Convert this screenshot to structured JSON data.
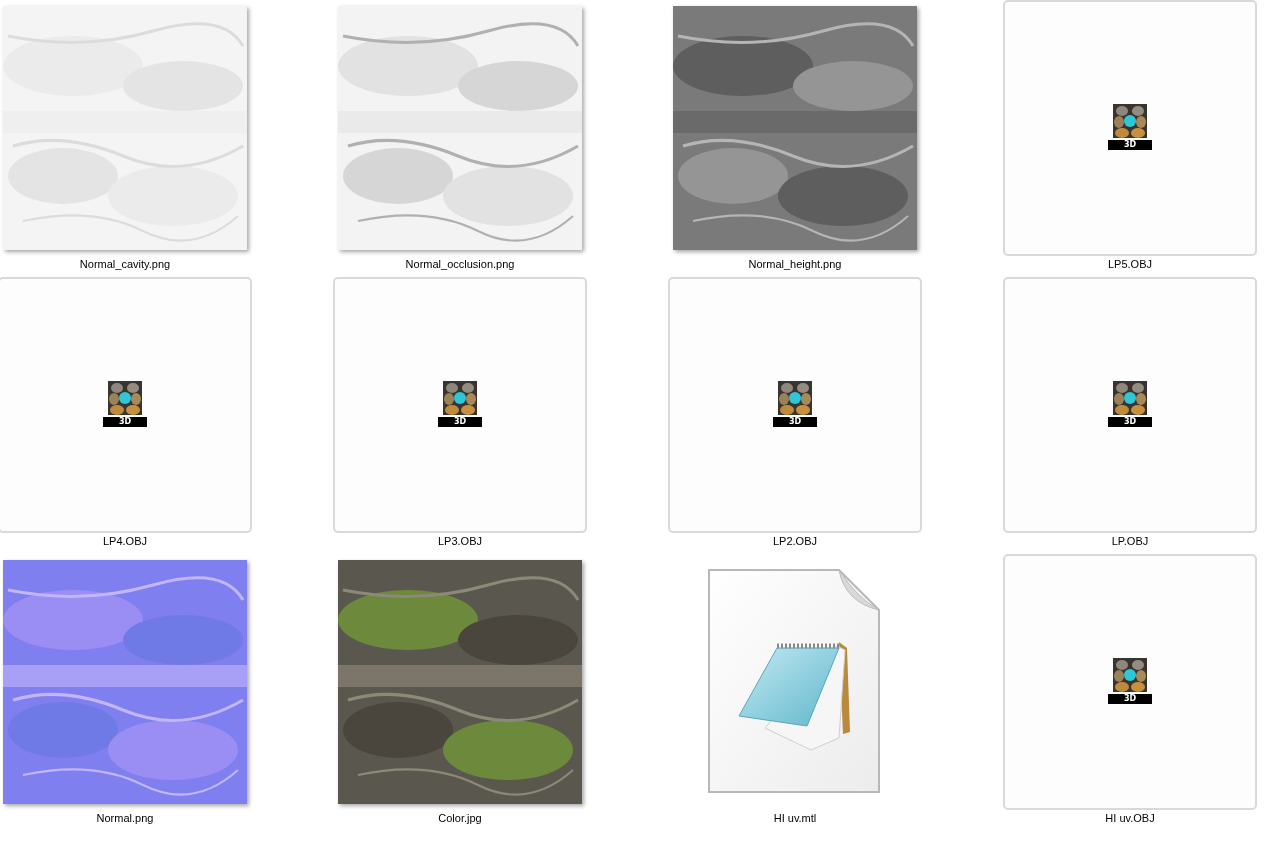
{
  "items": [
    {
      "name": "Normal_cavity.png",
      "kind": "picture"
    },
    {
      "name": "Normal_occlusion.png",
      "kind": "picture"
    },
    {
      "name": "Normal_height.png",
      "kind": "picture"
    },
    {
      "name": "LP5.OBJ",
      "kind": "model",
      "badge": "3D"
    },
    {
      "name": "LP4.OBJ",
      "kind": "model",
      "badge": "3D"
    },
    {
      "name": "LP3.OBJ",
      "kind": "model",
      "badge": "3D"
    },
    {
      "name": "LP2.OBJ",
      "kind": "model",
      "badge": "3D"
    },
    {
      "name": "LP.OBJ",
      "kind": "model",
      "badge": "3D"
    },
    {
      "name": "Normal.png",
      "kind": "picture"
    },
    {
      "name": "Color.jpg",
      "kind": "picture"
    },
    {
      "name": "HI uv.mtl",
      "kind": "document"
    },
    {
      "name": "HI uv.OBJ",
      "kind": "model",
      "badge": "3D"
    }
  ]
}
